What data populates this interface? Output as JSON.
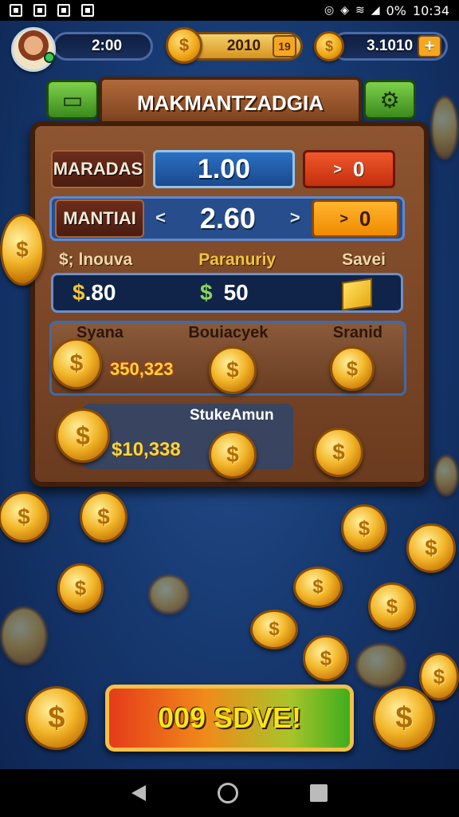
{
  "status_bar": {
    "battery": "0%",
    "time": "10:34"
  },
  "hud": {
    "timer": "2:00",
    "gold": "2010",
    "gold_badge": "19",
    "bank": "3.1010",
    "plus": "+",
    "coin_symbol": "$"
  },
  "title": "MAKMANTZADGIA",
  "rows": [
    {
      "label": "MARADAS",
      "value": "1.00",
      "button": "0",
      "button_caret": ">"
    },
    {
      "label": "MANTIAI",
      "value": "2.60",
      "button": "0",
      "button_caret": ">",
      "left_arrow": "<",
      "right_arrow": ">"
    }
  ],
  "stats": {
    "headers": [
      "$; lnouva",
      "Paranuriy",
      "Savei"
    ],
    "value1_symbol": "$",
    "value1": ".80",
    "value2_symbol": "$",
    "value2": "50"
  },
  "section1": {
    "headers": [
      "Syana",
      "Bouiacyek",
      "Sranid"
    ],
    "value": "350,323"
  },
  "section2": {
    "header": "StukeAmun",
    "value": "$10,338"
  },
  "play_button": "009 SDVE!",
  "colors": {
    "background": "#173a72",
    "panel": "#7a4526",
    "accent_gold": "#f3b72b",
    "button_red": "#e04a1f",
    "button_orange": "#f79b12"
  }
}
